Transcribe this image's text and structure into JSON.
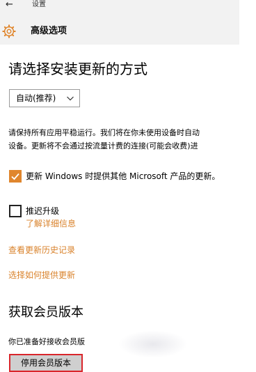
{
  "window": {
    "back_icon": "arrow-left-icon",
    "app_title": "设置"
  },
  "header": {
    "icon": "gear-icon",
    "title": "高级选项"
  },
  "install": {
    "heading": "请选择安装更新的方式",
    "dropdown_value": "自动(推荐)",
    "dropdown_icon": "chevron-down-icon"
  },
  "description": {
    "line1": "请保持所有应用平稳运行。我们将在你未使用设备时自动",
    "line2": "设备。更新将不会通过按流量计费的连接(可能会收费)进"
  },
  "options": {
    "microsoft_updates": {
      "label": "更新 Windows 时提供其他 Microsoft 产品的更新。",
      "checked": true
    },
    "defer_upgrades": {
      "label": "推迟升级",
      "checked": false,
      "link": "了解详细信息"
    }
  },
  "links": {
    "history": "查看更新历史记录",
    "delivery": "选择如何提供更新"
  },
  "insider": {
    "heading": "获取会员版本",
    "text": "你已准备好接收会员版",
    "stop_button": "停用会员版本"
  },
  "colors": {
    "accent": "#d9822b",
    "checkbox": "#e0862d",
    "highlight_border": "#d9262b",
    "header_bg": "#f2f2f2"
  }
}
